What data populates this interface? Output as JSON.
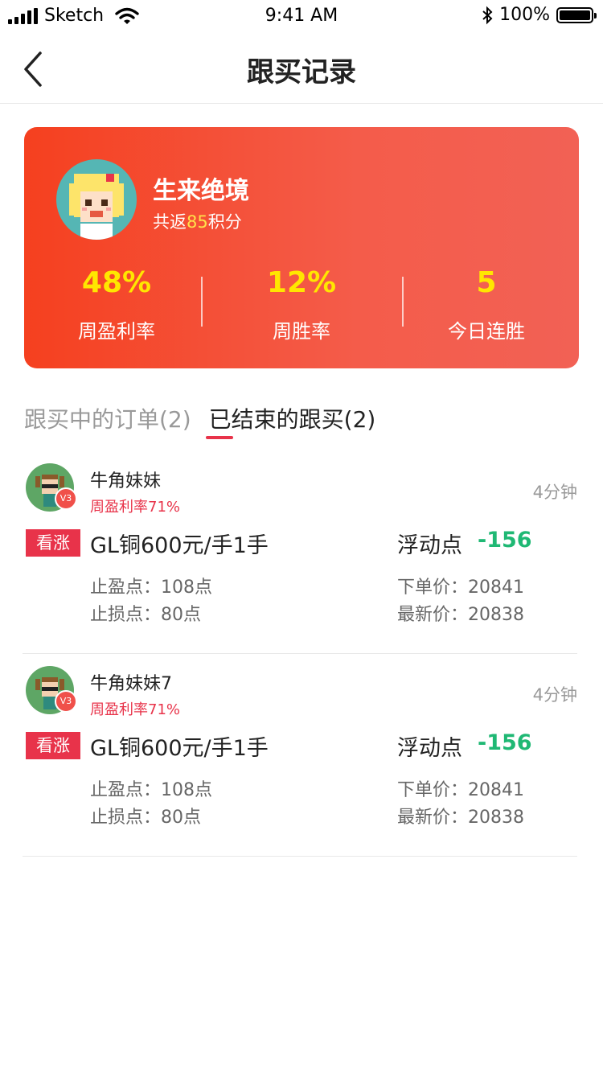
{
  "status_bar": {
    "carrier": "Sketch",
    "time": "9:41 AM",
    "battery": "100%"
  },
  "nav": {
    "title": "跟买记录"
  },
  "profile": {
    "name": "生来绝境",
    "sub_prefix": "共返",
    "points": "85",
    "sub_suffix": "积分",
    "stats": [
      {
        "value": "48%",
        "label": "周盈利率"
      },
      {
        "value": "12%",
        "label": "周胜率"
      },
      {
        "value": "5",
        "label": "今日连胜"
      }
    ]
  },
  "tabs": [
    {
      "label": "跟买中的订单(2)",
      "active": false
    },
    {
      "label": "已结束的跟买(2)",
      "active": true
    }
  ],
  "orders": [
    {
      "name": "牛角妹妹",
      "rate": "周盈利率71%",
      "time": "4分钟",
      "tag": "看涨",
      "product": "GL铜600元/手1手",
      "float_label": "浮动点",
      "float_value": "-156",
      "take_profit": "止盈点：108点",
      "stop_loss": "止损点：80点",
      "order_price": "下单价：20841",
      "latest_price": "最新价：20838",
      "badge": "V3"
    },
    {
      "name": "牛角妹妹7",
      "rate": "周盈利率71%",
      "time": "4分钟",
      "tag": "看涨",
      "product": "GL铜600元/手1手",
      "float_label": "浮动点",
      "float_value": "-156",
      "take_profit": "止盈点：108点",
      "stop_loss": "止损点：80点",
      "order_price": "下单价：20841",
      "latest_price": "最新价：20838",
      "badge": "V3"
    }
  ],
  "colors": {
    "accent": "#e8334a",
    "card_start": "#f5401f",
    "card_end": "#f26155",
    "positive_green": "#1fb874",
    "highlight_yellow": "#ffe600"
  }
}
